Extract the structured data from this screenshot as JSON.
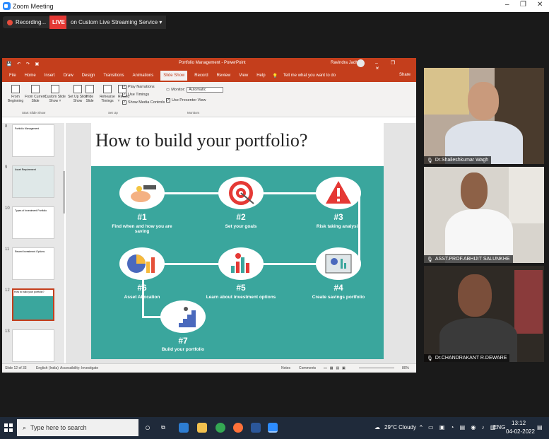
{
  "window": {
    "title": "Zoom Meeting",
    "controls": [
      "–",
      "❐",
      "✕"
    ]
  },
  "meeting": {
    "recording_label": "Recording...",
    "live_label": "LIVE",
    "stream_label": "on Custom Live Streaming Service ▾"
  },
  "ppt": {
    "doc_title": "Portfolio Management - PowerPoint",
    "user": "Ravindra Jadhav",
    "tabs": [
      "File",
      "Home",
      "Insert",
      "Draw",
      "Design",
      "Transitions",
      "Animations",
      "Slide Show",
      "Record",
      "Review",
      "View",
      "Help"
    ],
    "active_tab": "Slide Show",
    "tell_me": "Tell me what you want to do",
    "share": "Share",
    "ribbon": {
      "from_beginning": "From Beginning",
      "from_current": "From Current Slide",
      "custom_show": "Custom Slide Show ˅",
      "setup_show": "Set Up Slide Show",
      "hide_slide": "Hide Slide",
      "rehearse": "Rehearse Timings",
      "record": "Record ˅",
      "play_narrations": "Play Narrations",
      "use_timings": "Use Timings",
      "show_media": "Show Media Controls",
      "monitor_label": "Monitor:",
      "monitor_value": "Automatic",
      "presenter_view": "Use Presenter View",
      "grp_start": "Start Slide Show",
      "grp_setup": "Set Up",
      "grp_monitors": "Monitors"
    },
    "thumbnails": [
      {
        "num": "8",
        "title": "Portfolio Management"
      },
      {
        "num": "9",
        "title": "Asset Requirement"
      },
      {
        "num": "10",
        "title": "Types of Investment Portfolio"
      },
      {
        "num": "11",
        "title": "Recent Investment Options"
      },
      {
        "num": "12",
        "title": "How to build your portfolio?"
      },
      {
        "num": "13",
        "title": ""
      }
    ],
    "slide": {
      "title": "How to build your portfolio?",
      "steps": [
        {
          "num": "#1",
          "desc": "Find when and how you are saving"
        },
        {
          "num": "#2",
          "desc": "Set your goals"
        },
        {
          "num": "#3",
          "desc": "Risk taking analysis"
        },
        {
          "num": "#4",
          "desc": "Create savings portfolio"
        },
        {
          "num": "#5",
          "desc": "Learn about investment options"
        },
        {
          "num": "#6",
          "desc": "Asset Allocation"
        },
        {
          "num": "#7",
          "desc": "Build your portfolio"
        }
      ]
    },
    "status": {
      "slide_count": "Slide 12 of 33",
      "language": "English (India)",
      "accessibility": "Accessibility: Investigate",
      "notes": "Notes",
      "comments": "Comments",
      "zoom": "80%"
    }
  },
  "participants": [
    {
      "name": "Dr.Shaileshkumar Wagh"
    },
    {
      "name": "ASST.PROF.ABHIJIT SALUNKHE"
    },
    {
      "name": "Dr.CHANDRAKANT R.DEWARE"
    }
  ],
  "taskbar": {
    "search_placeholder": "Type here to search",
    "weather": "29°C Cloudy",
    "lang": "ENG",
    "time": "13:12",
    "date": "04-02-2022"
  },
  "colors": {
    "ppt_accent": "#c43e1c",
    "slide_teal": "#3aa69d",
    "zoom_blue": "#2d8cff",
    "live_red": "#e53935"
  }
}
